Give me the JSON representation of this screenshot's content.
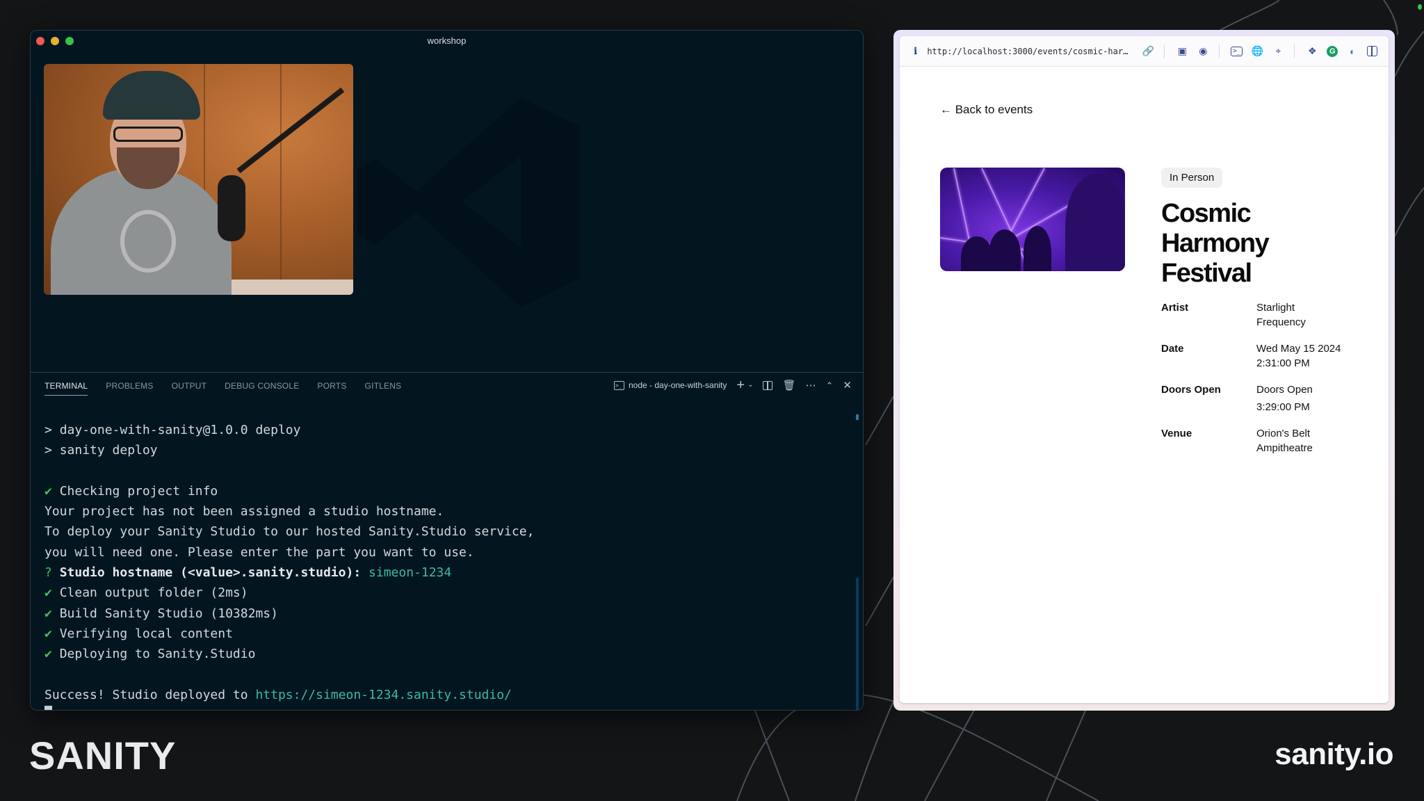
{
  "vscode": {
    "window_title": "workshop",
    "panel": {
      "tabs": [
        {
          "label": "TERMINAL",
          "active": true
        },
        {
          "label": "PROBLEMS",
          "active": false
        },
        {
          "label": "OUTPUT",
          "active": false
        },
        {
          "label": "DEBUG CONSOLE",
          "active": false
        },
        {
          "label": "PORTS",
          "active": false
        },
        {
          "label": "GITLENS",
          "active": false
        }
      ],
      "terminal_name": "node - day-one-with-sanity",
      "actions": [
        "new-terminal",
        "terminal-dropdown",
        "split-terminal",
        "kill-terminal",
        "more-actions",
        "maximize-panel",
        "close-panel"
      ]
    },
    "terminal": {
      "lines": [
        {
          "prefix": "> ",
          "text": "day-one-with-sanity@1.0.0 deploy"
        },
        {
          "prefix": "> ",
          "text": "sanity deploy"
        },
        {
          "prefix": "",
          "text": ""
        },
        {
          "prefix": "✔ ",
          "text": "Checking project info",
          "kind": "check"
        },
        {
          "prefix": "",
          "text": "Your project has not been assigned a studio hostname."
        },
        {
          "prefix": "",
          "text": "To deploy your Sanity Studio to our hosted Sanity.Studio service,"
        },
        {
          "prefix": "",
          "text": "you will need one. Please enter the part you want to use."
        },
        {
          "prefix": "? ",
          "text": "Studio hostname (<value>.sanity.studio): ",
          "answer": "simeon-1234",
          "kind": "prompt"
        },
        {
          "prefix": "✔ ",
          "text": "Clean output folder (2ms)",
          "kind": "check"
        },
        {
          "prefix": "✔ ",
          "text": "Build Sanity Studio (10382ms)",
          "kind": "check"
        },
        {
          "prefix": "✔ ",
          "text": "Verifying local content",
          "kind": "check"
        },
        {
          "prefix": "✔ ",
          "text": "Deploying to Sanity.Studio",
          "kind": "check"
        },
        {
          "prefix": "",
          "text": ""
        },
        {
          "prefix": "",
          "text": "Success! Studio deployed to ",
          "link": "https://simeon-1234.sanity.studio/",
          "kind": "success"
        }
      ]
    }
  },
  "browser": {
    "url": "http://localhost:3000/events/cosmic-har…",
    "toolbar_icons": [
      "info-icon",
      "link-icon",
      "screenshot-icon",
      "camera-icon",
      "terminal-icon",
      "globe-icon",
      "crosshair-icon",
      "extensions-icon",
      "grammarly-icon",
      "privacy-icon",
      "sidebar-icon"
    ],
    "page": {
      "back_link": "← Back to events",
      "badge": "In Person",
      "title": "Cosmic Harmony Festival",
      "details": [
        {
          "label": "Artist",
          "value": [
            "Starlight",
            "Frequency"
          ]
        },
        {
          "label": "Date",
          "value": [
            "Wed May 15 2024",
            "2:31:00 PM"
          ]
        },
        {
          "label": "Doors Open",
          "value": [
            "Doors Open",
            "3:29:00 PM"
          ]
        },
        {
          "label": "Venue",
          "value": [
            "Orion's Belt",
            "Ampitheatre"
          ]
        }
      ]
    }
  },
  "branding": {
    "logo_text": "SANITY",
    "site": "sanity.io"
  }
}
